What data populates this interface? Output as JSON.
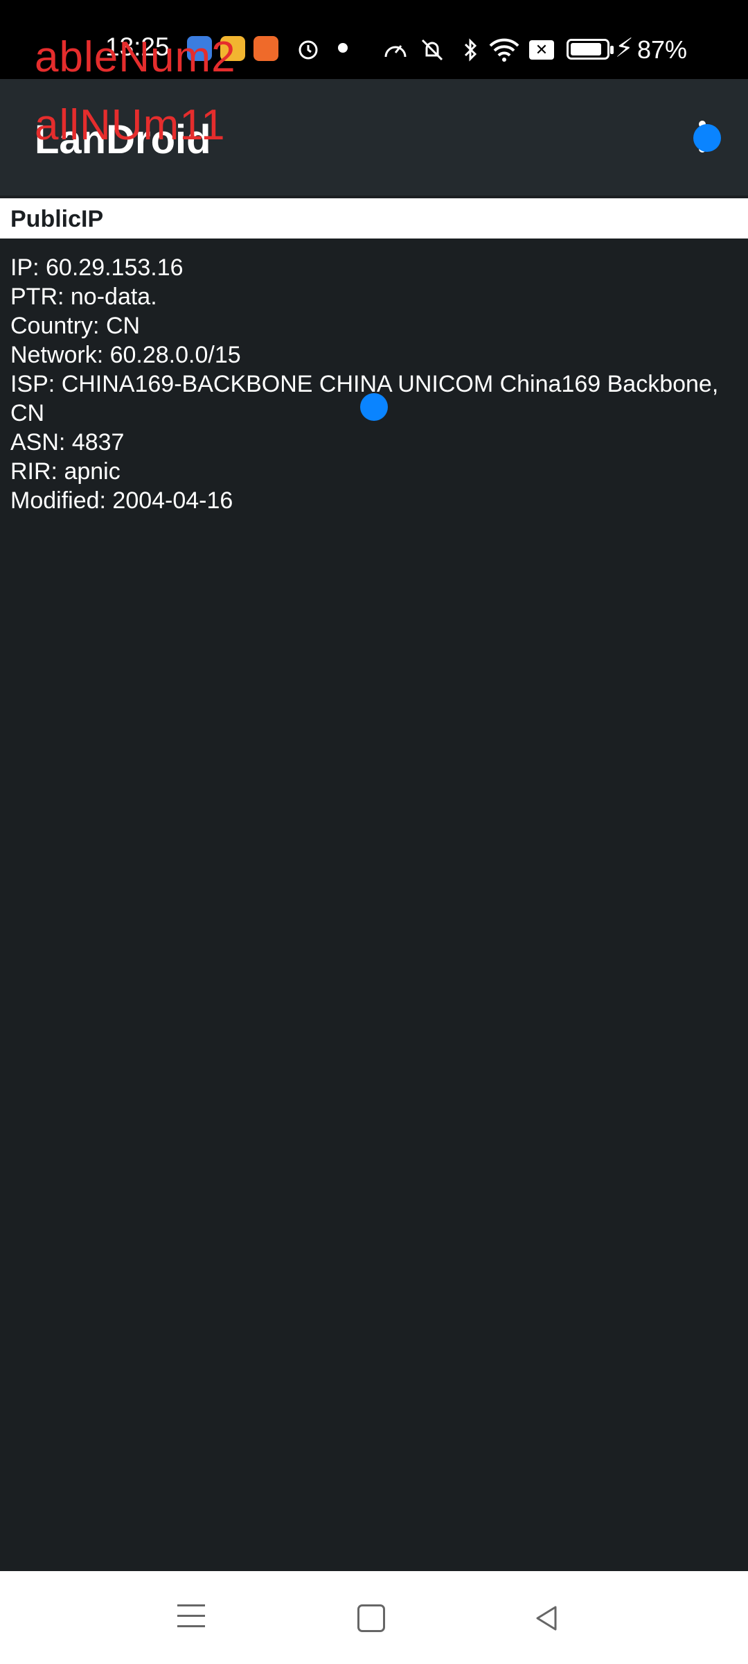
{
  "status_bar": {
    "time": "13:25",
    "battery_percent": "87%",
    "battery_level": 0.87,
    "icons": [
      "app-notification-icon",
      "app-notification-icon",
      "app-notification-icon",
      "alarm-icon",
      "dot-icon",
      "speedometer-icon",
      "mute-bell-icon",
      "bluetooth-icon",
      "wifi-icon",
      "close-box-icon",
      "battery-icon",
      "charging-bolt-icon"
    ]
  },
  "annotations": {
    "line1": "ableNum2",
    "line2": "allNUm11",
    "color": "#e52d2d"
  },
  "app_bar": {
    "title": "LanDroid",
    "menu_icon": "more-vert-icon"
  },
  "section": {
    "title": "PublicIP"
  },
  "info": {
    "lines": [
      "IP: 60.29.153.16",
      "PTR: no-data.",
      "Country: CN",
      "Network: 60.28.0.0/15",
      "ISP: CHINA169-BACKBONE CHINA UNICOM China169 Backbone, CN",
      "ASN: 4837",
      "RIR: apnic",
      "Modified: 2004-04-16"
    ]
  },
  "nav_bar": {
    "icons": [
      "menu-icon",
      "home-square-icon",
      "back-triangle-icon"
    ]
  },
  "colors": {
    "background": "#1b1f22",
    "app_bar": "#242a2e",
    "touch_indicator": "#0a84ff"
  }
}
